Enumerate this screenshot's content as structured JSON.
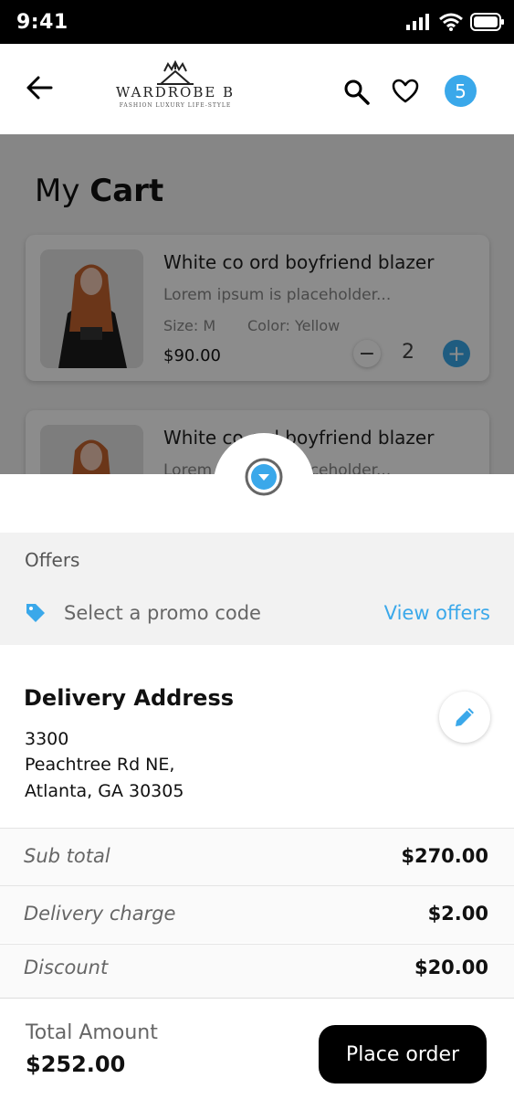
{
  "status": {
    "time": "9:41"
  },
  "header": {
    "brand": "WARDROBE B",
    "tagline": "FASHION LUXURY LIFE-STYLE",
    "cart_count": "5"
  },
  "cart": {
    "title_prefix": "My",
    "title_bold": "Cart",
    "items": [
      {
        "name": "White co ord boyfriend blazer",
        "desc": "Lorem ipsum is placeholder...",
        "size": "Size: M",
        "color": "Color: Yellow",
        "price": "$90.00",
        "qty": "2"
      },
      {
        "name": "White co ord boyfriend blazer",
        "desc": "Lorem ipsum is placeholder..."
      }
    ]
  },
  "offers": {
    "title": "Offers",
    "promo_placeholder": "Select a promo code",
    "view_label": "View offers"
  },
  "address": {
    "title": "Delivery Address",
    "line1": "3300",
    "line2": "Peachtree Rd NE,",
    "line3": "Atlanta, GA 30305"
  },
  "summary": [
    {
      "label": "Sub total",
      "value": "$270.00"
    },
    {
      "label": "Delivery charge",
      "value": "$2.00"
    },
    {
      "label": "Discount",
      "value": "$20.00"
    }
  ],
  "footer": {
    "total_label": "Total Amount",
    "total_value": "$252.00",
    "place_order": "Place order"
  },
  "colors": {
    "accent": "#3aa8ea",
    "dark": "#000000"
  }
}
